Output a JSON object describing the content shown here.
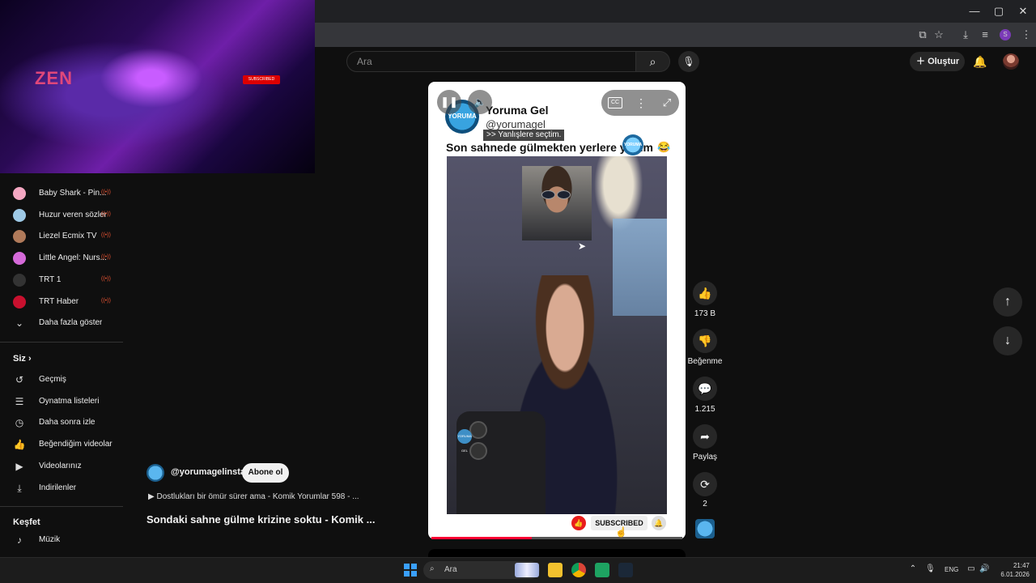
{
  "window_controls": {
    "minimize": "—",
    "maximize": "▢",
    "close": "✕"
  },
  "header": {
    "search_placeholder": "Ara",
    "create_label": "Oluştur"
  },
  "overlay_video": {
    "logo_text": "ZEN",
    "subscribed_badge": "SUBSCRIBED"
  },
  "sidebar": {
    "subscriptions": [
      {
        "label": "Baby Shark - Pin...",
        "color": "#f4a7c2"
      },
      {
        "label": "Huzur veren sözler",
        "color": "#9ec9e6"
      },
      {
        "label": "Liezel Ecmix TV",
        "color": "#b07a5a"
      },
      {
        "label": "Little Angel: Nurs...",
        "color": "#d56ad9"
      },
      {
        "label": "TRT 1",
        "color": "#333333"
      },
      {
        "label": "TRT Haber",
        "color": "#c8102e"
      }
    ],
    "show_more": "Daha fazla göster",
    "you_section": "Siz",
    "you_items": [
      {
        "label": "Geçmiş",
        "icon": "history-icon"
      },
      {
        "label": "Oynatma listeleri",
        "icon": "playlist-icon"
      },
      {
        "label": "Daha sonra izle",
        "icon": "clock-icon"
      },
      {
        "label": "Beğendiğim videolar",
        "icon": "thumbs-up-icon"
      },
      {
        "label": "Videolarınız",
        "icon": "video-icon"
      },
      {
        "label": "İndirilenler",
        "icon": "download-icon"
      }
    ],
    "explore_section": "Keşfet",
    "explore_items": [
      {
        "label": "Müzik",
        "icon": "music-icon"
      }
    ]
  },
  "short": {
    "channel_name": "Yoruma Gel",
    "channel_handle": "@yorumagel",
    "logo_text": "YORUMA GEL",
    "tooltip": ">> Yanlışlere seçtim.",
    "post_text": "Son sahnede gülmekten yerlere yattım",
    "subscribed": "SUBSCRIBED",
    "progress": 0.4
  },
  "actions": {
    "like_count": "173 B",
    "dislike_label": "Beğenme",
    "comment_count": "1.215",
    "share_label": "Paylaş",
    "remix_count": "2"
  },
  "below": {
    "handle": "@yorumagelinsta",
    "subscribe_label": "Abone ol",
    "playlist_line": "▶ Dostlukları bir ömür sürer ama - Komik Yorumlar 598 - ...",
    "title": "Sondaki sahne gülme krizine soktu - Komik ..."
  },
  "taskbar": {
    "search_label": "Ara",
    "language": "ENG",
    "time": "21:47",
    "date": "6.01.2026"
  }
}
